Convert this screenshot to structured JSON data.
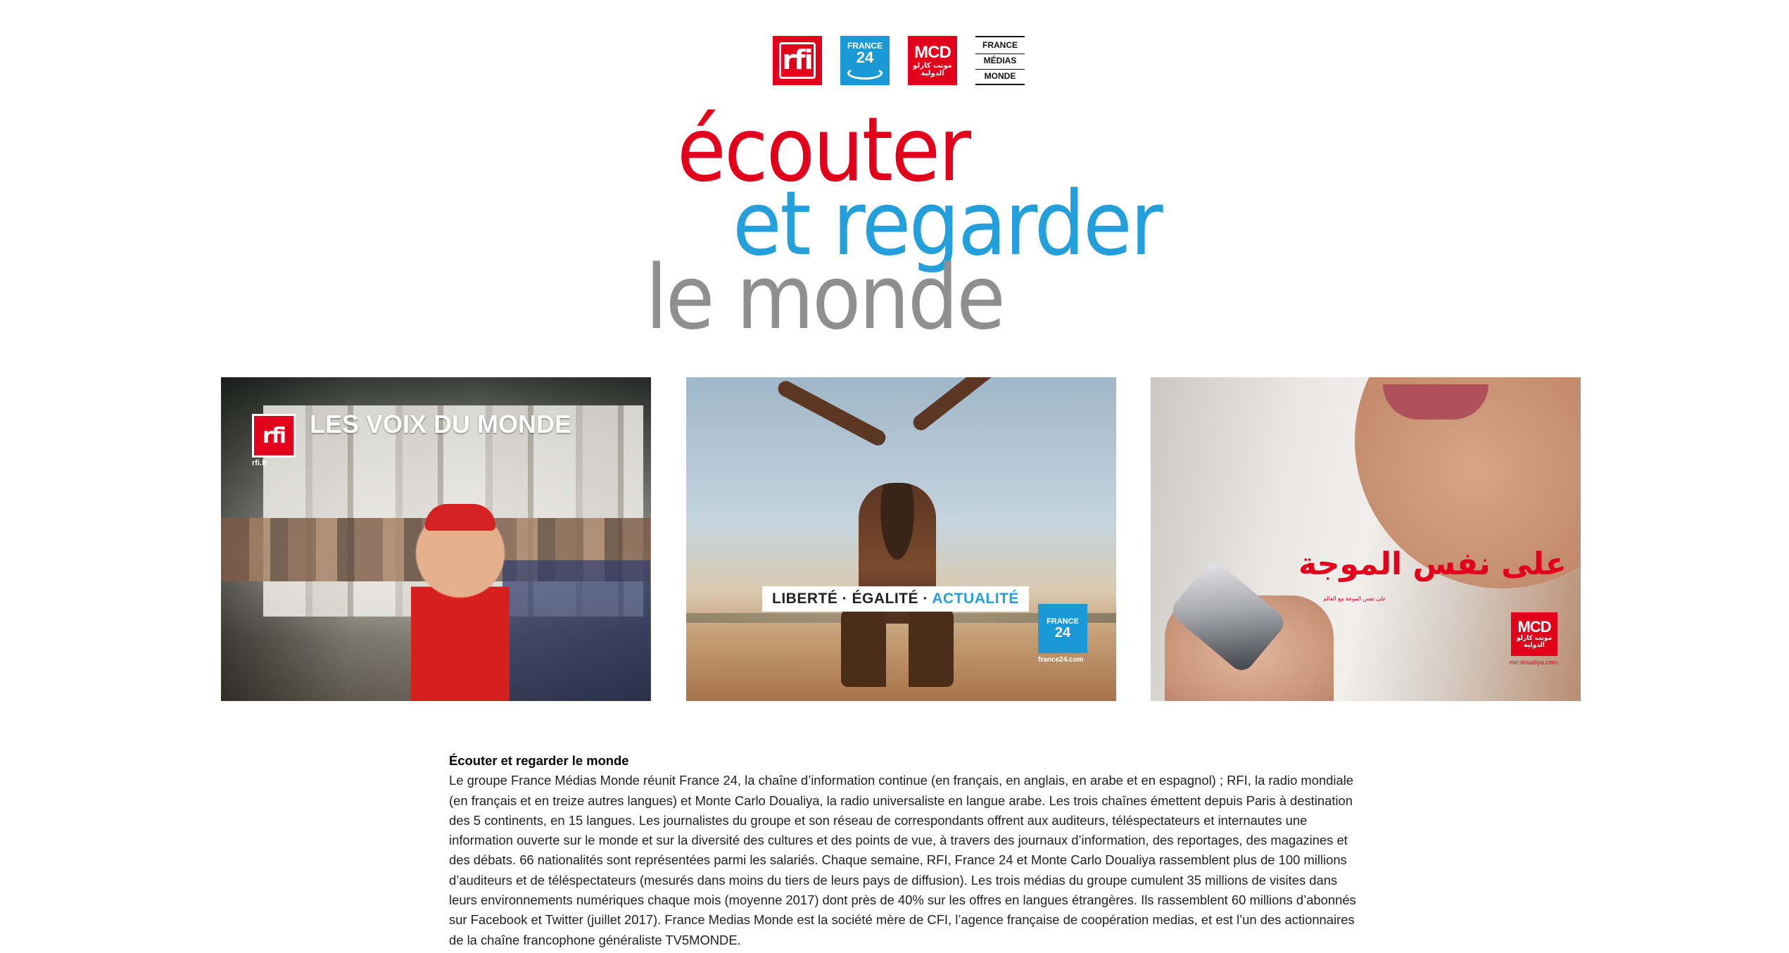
{
  "logos": {
    "rfi": "rfi",
    "france24": {
      "line1": "FRANCE",
      "line2": "24"
    },
    "mcd": {
      "line1": "MCD",
      "line2": "مونت كارلو",
      "line3": "الدولية"
    },
    "fmm": [
      "FRANCE",
      "MÉDIAS",
      "MONDE"
    ]
  },
  "headline": {
    "line1": "écouter",
    "line2": "et regarder",
    "line3": "le monde"
  },
  "panels": {
    "rfi": {
      "logo": "rfi",
      "url": "rfi.fr",
      "tagline": "LES VOIX DU MONDE"
    },
    "france24": {
      "banner_part1": "LIBERTÉ · ÉGALITÉ · ",
      "banner_part2": "ACTUALITÉ",
      "logo_line1": "FRANCE",
      "logo_line2": "24",
      "url": "france24.com"
    },
    "mcd": {
      "arabic": "على نفس الموجة",
      "sub": "على نفس الموجة مع العالم",
      "logo_line1": "MCD",
      "logo_line2": "مونت كارلو الدولية",
      "url": "mc-doualiya.com"
    }
  },
  "article": {
    "title": "Écouter et regarder le monde",
    "body": "Le groupe France Médias Monde réunit France 24, la chaîne d’information continue (en français, en anglais, en arabe et en espagnol) ; RFI, la radio mondiale (en français et en treize autres langues) et Monte Carlo Doualiya, la radio universaliste en langue arabe. Les trois chaînes émettent depuis Paris à destination des 5 continents, en 15 langues. Les journalistes du groupe et son réseau de correspondants offrent aux auditeurs, téléspectateurs et internautes une information ouverte sur le monde et sur la diversité des cultures et des points de vue, à travers des journaux d’information, des reportages, des magazines et des débats. 66 nationalités sont représentées parmi les salariés. Chaque semaine, RFI, France 24 et Monte Carlo Doualiya rassemblent plus de 100 millions d’auditeurs et de téléspectateurs (mesurés dans moins du tiers de leurs pays de diffusion). Les trois médias du groupe cumulent 35 millions de visites dans leurs environnements numériques chaque mois (moyenne 2017) dont près de 40% sur les offres en langues étrangères. Ils rassemblent 60 millions d’abonnés sur Facebook et Twitter (juillet 2017). France Medias Monde est la société mère de CFI, l’agence française de coopération medias, et est l’un des actionnaires de la chaîne francophone généraliste TV5MONDE."
  },
  "colors": {
    "rfi_red": "#e2001a",
    "france24_blue": "#23a0dc",
    "headline_grey": "#8f8f8f"
  }
}
